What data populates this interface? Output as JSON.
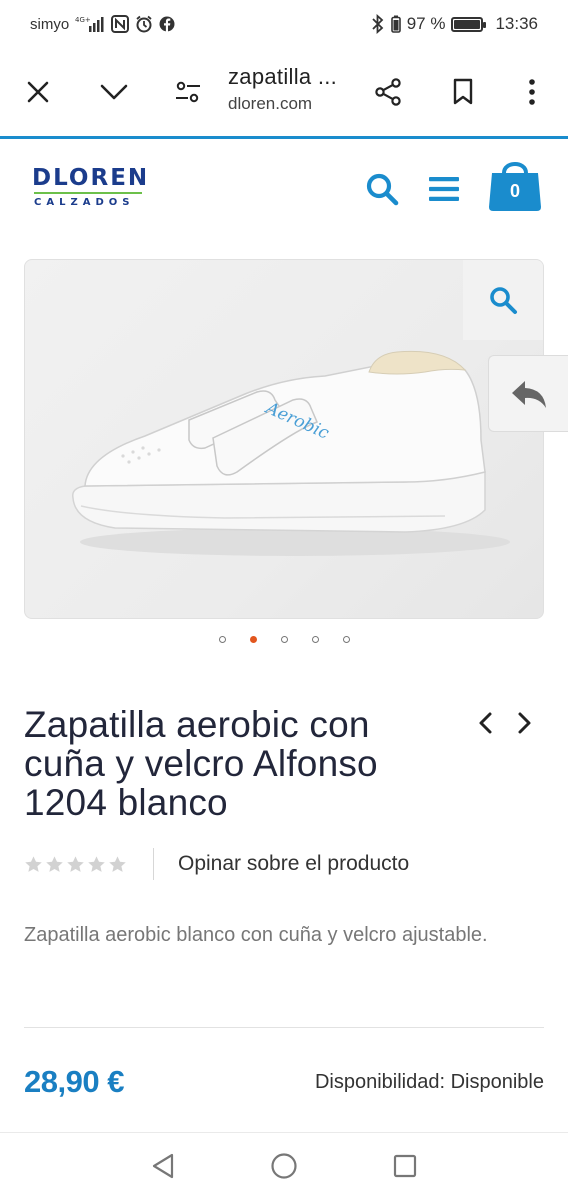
{
  "status_bar": {
    "carrier": "simyo",
    "network": "4G+",
    "battery_percent": "97 %",
    "battery_level": 0.97,
    "time": "13:36"
  },
  "browser": {
    "page_title": "zapatilla ...",
    "domain": "dloren.com"
  },
  "site": {
    "logo_main": "DLOREN",
    "logo_sub": "CALZADOS",
    "cart_count": "0",
    "accent_color": "#1a8ccd"
  },
  "gallery": {
    "image_alt": "Zapatilla blanca aerobic con velcro",
    "shoe_brand_text": "Aerobic",
    "slide_count": 5,
    "active_slide": 2
  },
  "product": {
    "title": "Zapatilla aerobic con cuña y velcro Alfonso 1204 blanco",
    "rating_stars": 0,
    "rating_max": 5,
    "review_link": "Opinar sobre el producto",
    "description": "Zapatilla aerobic blanco con cuña y velcro ajustable.",
    "price": "28,90 €",
    "availability_label": "Disponibilidad:",
    "availability_value": "Disponible",
    "price_color": "#1a7fc2"
  }
}
